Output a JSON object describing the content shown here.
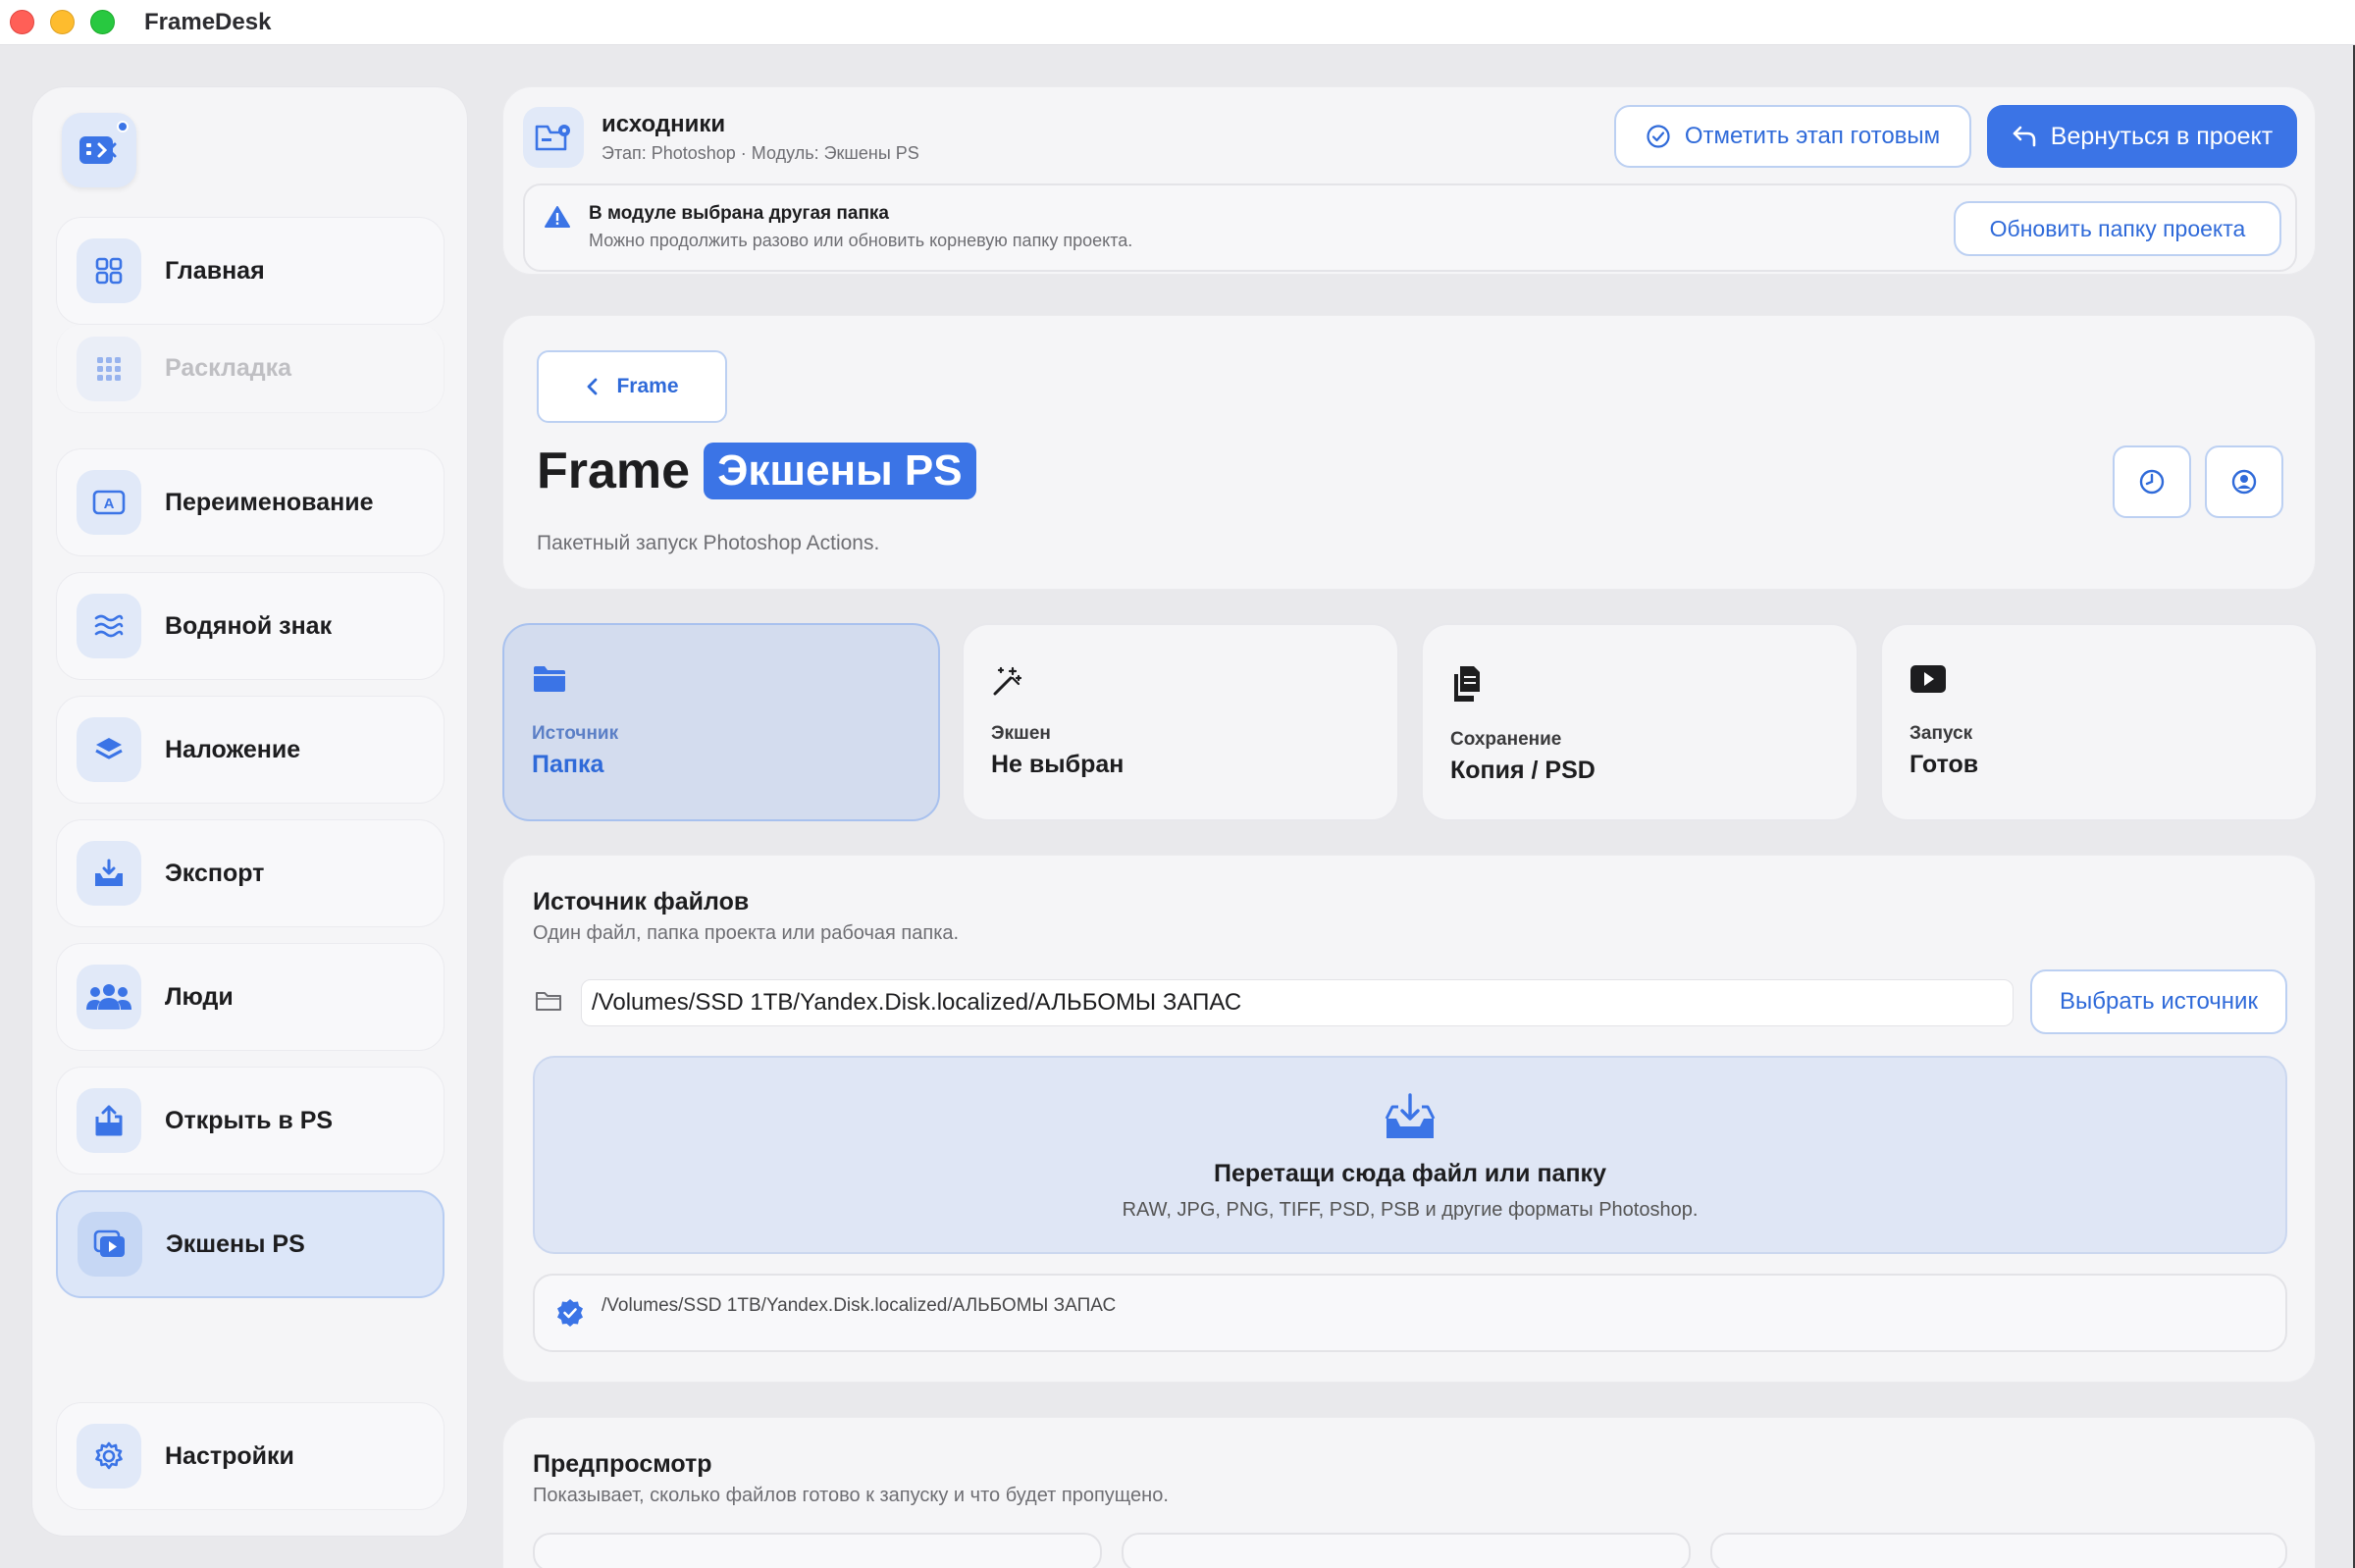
{
  "window": {
    "app_title": "FrameDesk"
  },
  "sidebar": {
    "items": [
      {
        "label": "Главная",
        "icon": "grid-icon",
        "active": false
      },
      {
        "label": "Раскладка",
        "icon": "dots-grid-icon",
        "active": false,
        "faded": true
      },
      {
        "label": "Переименование",
        "icon": "rename-icon",
        "active": false
      },
      {
        "label": "Водяной знак",
        "icon": "waves-icon",
        "active": false
      },
      {
        "label": "Наложение",
        "icon": "layers-icon",
        "active": false
      },
      {
        "label": "Экспорт",
        "icon": "export-tray-icon",
        "active": false
      },
      {
        "label": "Люди",
        "icon": "people-icon",
        "active": false
      },
      {
        "label": "Открыть в PS",
        "icon": "open-upload-icon",
        "active": false
      },
      {
        "label": "Экшены PS",
        "icon": "play-stack-icon",
        "active": true
      },
      {
        "label": "Настройки",
        "icon": "gear-icon",
        "active": false
      }
    ]
  },
  "header": {
    "title": "исходники",
    "subtitle": "Этап: Photoshop · Модуль: Экшены PS",
    "mark_done_label": "Отметить этап готовым",
    "return_label": "Вернуться в проект",
    "alert": {
      "title": "В модуле выбрана другая папка",
      "text": "Можно продолжить разово или обновить корневую папку проекта.",
      "button": "Обновить папку проекта"
    }
  },
  "page": {
    "back_label": "Frame",
    "title_main": "Frame",
    "title_badge": "Экшены PS",
    "description": "Пакетный запуск Photoshop Actions."
  },
  "steps": [
    {
      "label": "Источник",
      "value": "Папка",
      "icon": "folder-icon",
      "active": true
    },
    {
      "label": "Экшен",
      "value": "Не выбран",
      "icon": "magic-wand-icon",
      "active": false
    },
    {
      "label": "Сохранение",
      "value": "Копия / PSD",
      "icon": "copy-files-icon",
      "active": false
    },
    {
      "label": "Запуск",
      "value": "Готов",
      "icon": "play-icon",
      "active": false
    }
  ],
  "source": {
    "title": "Источник файлов",
    "subtitle": "Один файл, папка проекта или рабочая папка.",
    "path": "/Volumes/SSD 1TB/Yandex.Disk.localized/АЛЬБОМЫ ЗАПАС",
    "choose_label": "Выбрать источник",
    "drop_title": "Перетащи сюда файл или папку",
    "drop_sub": "RAW, JPG, PNG, TIFF, PSD, PSB и другие форматы Photoshop.",
    "selected_path": "/Volumes/SSD 1TB/Yandex.Disk.localized/АЛЬБОМЫ ЗАПАС"
  },
  "preview": {
    "title": "Предпросмотр",
    "subtitle": "Показывает, сколько файлов готово к запуску и что будет пропущено."
  },
  "colors": {
    "accent": "#3b74e6",
    "accent_text": "#2f6ad9",
    "background": "#e9e9ec",
    "card": "#f5f5f7",
    "active_step": "#d3dcee"
  }
}
